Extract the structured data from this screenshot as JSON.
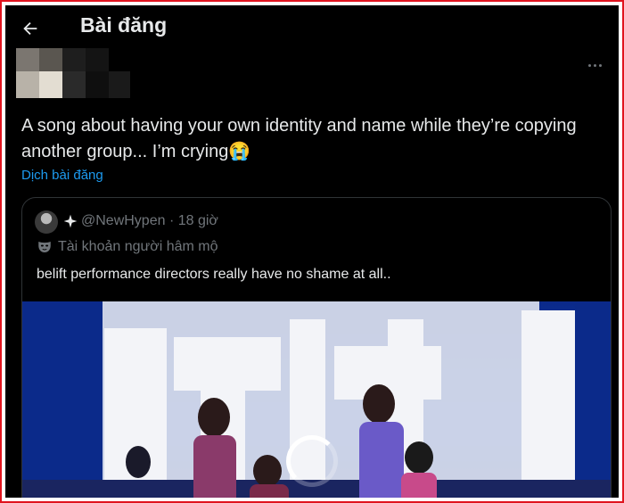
{
  "header": {
    "title": "Bài đăng",
    "back_icon": "arrow-left-icon"
  },
  "post": {
    "text": "A song about having your own identity and name while they’re copying another group... I’m crying😭",
    "translate_label": "Dịch bài đăng",
    "more_icon": "more-horizontal-icon"
  },
  "quote": {
    "handle_meta": "@NewHypen · 18 giờ",
    "fan_label": "Tài khoản người hâm mộ",
    "text": "belift performance directors really have no shame at all..",
    "verified_icon": "sparkle-icon",
    "fan_icon": "mask-icon"
  },
  "colors": {
    "background": "#000000",
    "text": "#e7e9ea",
    "muted": "#71767b",
    "link": "#1d9bf0",
    "border": "#2f3336",
    "frame": "#e0141e"
  }
}
